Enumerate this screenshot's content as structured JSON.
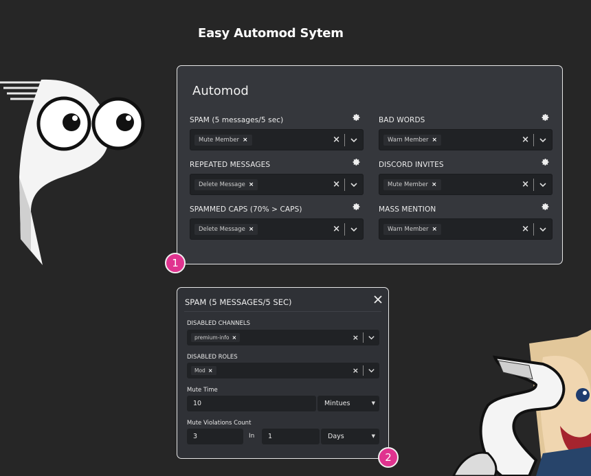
{
  "page": {
    "title": "Easy Automod Sytem"
  },
  "automod": {
    "title": "Automod",
    "rules": [
      {
        "label": "SPAM (5 messages/5 sec)",
        "action": "Mute Member"
      },
      {
        "label": "BAD WORDS",
        "action": "Warn Member"
      },
      {
        "label": "REPEATED MESSAGES",
        "action": "Delete Message"
      },
      {
        "label": "DISCORD INVITES",
        "action": "Mute Member"
      },
      {
        "label": "SPAMMED CAPS (70% > CAPS)",
        "action": "Delete Message"
      },
      {
        "label": "MASS MENTION",
        "action": "Warn Member"
      }
    ],
    "chip_remove": "×",
    "clear": "×"
  },
  "badges": {
    "one": "1",
    "two": "2"
  },
  "spam_settings": {
    "title": "SPAM (5 MESSAGES/5 SEC)",
    "disabled_channels_label": "DISABLED CHANNELS",
    "disabled_channels_value": "premium-info",
    "disabled_roles_label": "DISABLED ROLES",
    "disabled_roles_value": "Mod",
    "mute_time_label": "Mute Time",
    "mute_time_value": "10",
    "mute_time_unit": "Mintues",
    "violations_label": "Mute Violations Count",
    "violations_count": "3",
    "in_label": "In",
    "violations_period": "1",
    "violations_unit": "Days"
  },
  "colors": {
    "badge": "#e0338f",
    "panel": "#35373c",
    "input": "#202225"
  }
}
